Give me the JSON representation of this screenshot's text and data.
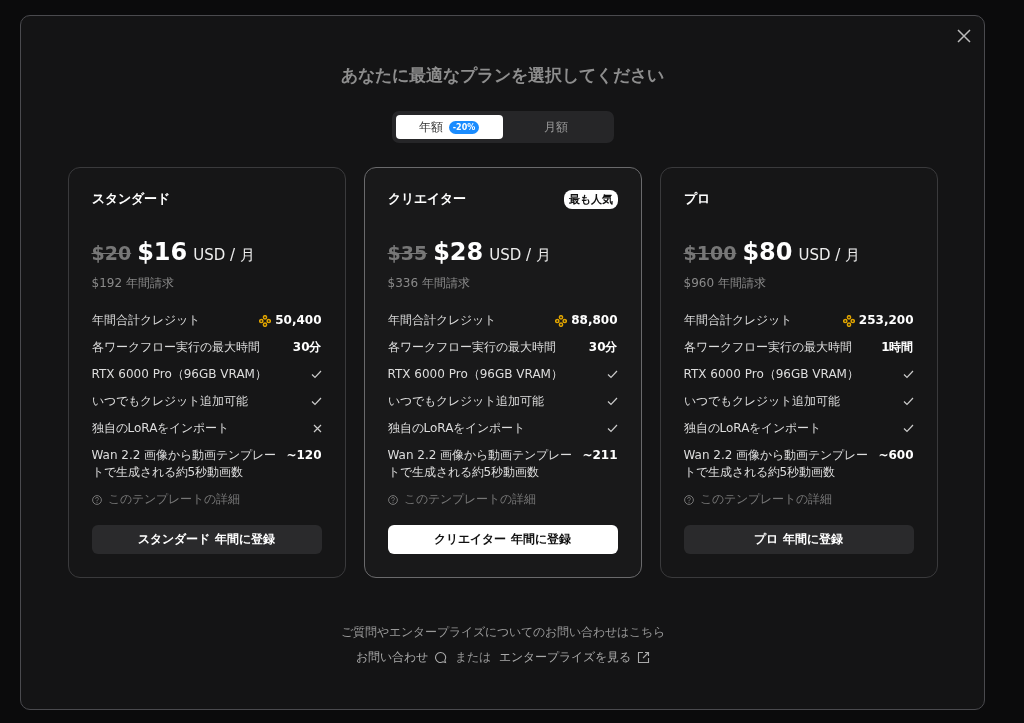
{
  "dialog": {
    "title": "あなたに最適なプランを選択してください"
  },
  "billing_toggle": [
    {
      "label": "年額",
      "badge": "-20%",
      "selected": true
    },
    {
      "label": "月額",
      "selected": false
    }
  ],
  "plans": [
    {
      "name": "スタンダード",
      "featured": false,
      "old_price": "$20",
      "price": "$16",
      "unit": "USD / 月",
      "billed": "$192 年間請求",
      "features": [
        {
          "kind": "credits",
          "label": "年間合計クレジット",
          "value": "50,400"
        },
        {
          "kind": "value",
          "label": "各ワークフロー実行の最大時間",
          "value": "30分"
        },
        {
          "kind": "check",
          "label": "RTX 6000 Pro（96GB VRAM）",
          "included": true
        },
        {
          "kind": "check",
          "label": "いつでもクレジット追加可能",
          "included": true
        },
        {
          "kind": "check",
          "label": "独自のLoRAをインポート",
          "included": false
        },
        {
          "kind": "value",
          "label": "Wan 2.2 画像から動画テンプレートで生成される約5秒動画数",
          "value": "~120"
        }
      ],
      "details_link": "このテンプレートの詳細",
      "button": "スタンダード 年間に登録"
    },
    {
      "name": "クリエイター",
      "featured": true,
      "badge": "最も人気",
      "old_price": "$35",
      "price": "$28",
      "unit": "USD / 月",
      "billed": "$336 年間請求",
      "features": [
        {
          "kind": "credits",
          "label": "年間合計クレジット",
          "value": "88,800"
        },
        {
          "kind": "value",
          "label": "各ワークフロー実行の最大時間",
          "value": "30分"
        },
        {
          "kind": "check",
          "label": "RTX 6000 Pro（96GB VRAM）",
          "included": true
        },
        {
          "kind": "check",
          "label": "いつでもクレジット追加可能",
          "included": true
        },
        {
          "kind": "check",
          "label": "独自のLoRAをインポート",
          "included": true
        },
        {
          "kind": "value",
          "label": "Wan 2.2 画像から動画テンプレートで生成される約5秒動画数",
          "value": "~211"
        }
      ],
      "details_link": "このテンプレートの詳細",
      "button": "クリエイター 年間に登録"
    },
    {
      "name": "プロ",
      "featured": false,
      "old_price": "$100",
      "price": "$80",
      "unit": "USD / 月",
      "billed": "$960 年間請求",
      "features": [
        {
          "kind": "credits",
          "label": "年間合計クレジット",
          "value": "253,200"
        },
        {
          "kind": "value",
          "label": "各ワークフロー実行の最大時間",
          "value": "1時間"
        },
        {
          "kind": "check",
          "label": "RTX 6000 Pro（96GB VRAM）",
          "included": true
        },
        {
          "kind": "check",
          "label": "いつでもクレジット追加可能",
          "included": true
        },
        {
          "kind": "check",
          "label": "独自のLoRAをインポート",
          "included": true
        },
        {
          "kind": "value",
          "label": "Wan 2.2 画像から動画テンプレートで生成される約5秒動画数",
          "value": "~600"
        }
      ],
      "details_link": "このテンプレートの詳細",
      "button": "プロ 年間に登録"
    }
  ],
  "footer": {
    "question": "ご質問やエンタープライズについてのお問い合わせはこちら",
    "contact_link": "お問い合わせ",
    "separator": "または",
    "enterprise_link": "エンタープライズを見る"
  }
}
